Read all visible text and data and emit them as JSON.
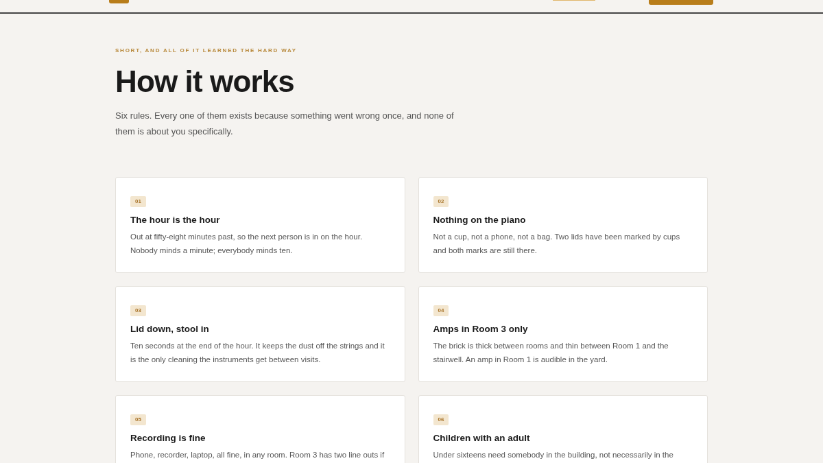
{
  "section": {
    "eyebrow": "SHORT, AND ALL OF IT LEARNED THE HARD WAY",
    "title": "How it works",
    "intro": "Six rules. Every one of them exists because something went wrong once, and none of them is about you specifically."
  },
  "rules": [
    {
      "number": "01",
      "title": "The hour is the hour",
      "body": "Out at fifty-eight minutes past, so the next person is in on the hour. Nobody minds a minute; everybody minds ten."
    },
    {
      "number": "02",
      "title": "Nothing on the piano",
      "body": "Not a cup, not a phone, not a bag. Two lids have been marked by cups and both marks are still there."
    },
    {
      "number": "03",
      "title": "Lid down, stool in",
      "body": "Ten seconds at the end of the hour. It keeps the dust off the strings and it is the only cleaning the instruments get between visits."
    },
    {
      "number": "04",
      "title": "Amps in Room 3 only",
      "body": "The brick is thick between rooms and thin between Room 1 and the stairwell. An amp in Room 1 is audible in the yard."
    },
    {
      "number": "05",
      "title": "Recording is fine",
      "body": "Phone, recorder, laptop, all fine, in any room. Room 3 has two line outs if"
    },
    {
      "number": "06",
      "title": "Children with an adult",
      "body": "Under sixteens need somebody in the building, not necessarily in the"
    }
  ]
}
